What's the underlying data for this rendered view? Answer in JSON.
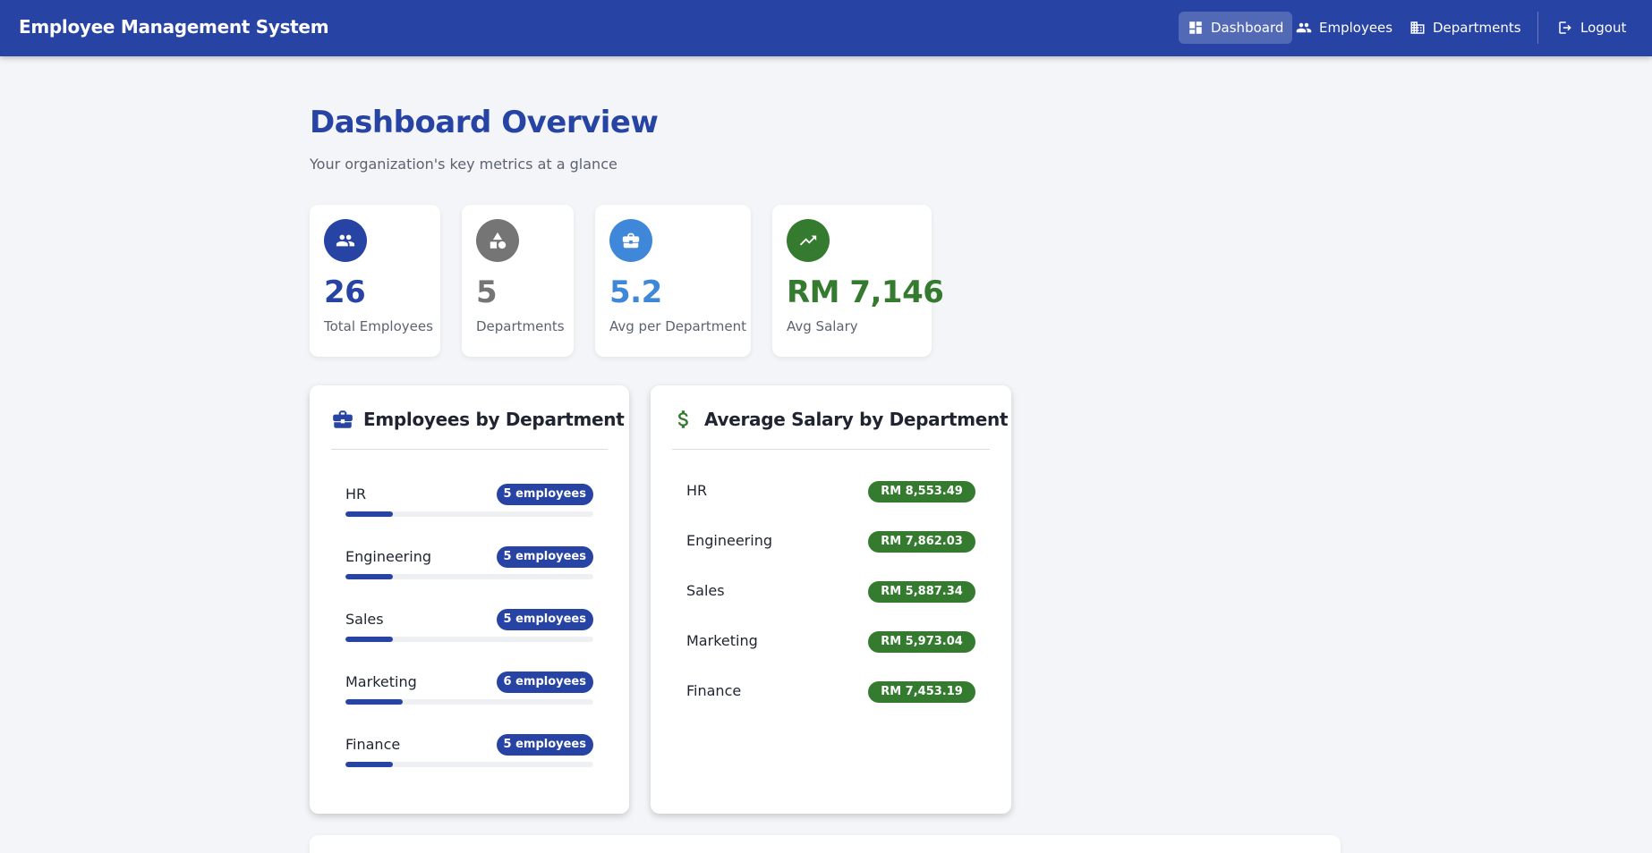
{
  "app": {
    "title": "Employee Management System"
  },
  "nav": {
    "items": [
      {
        "label": "Dashboard",
        "icon": "dashboard-icon",
        "active": true
      },
      {
        "label": "Employees",
        "icon": "people-icon",
        "active": false
      },
      {
        "label": "Departments",
        "icon": "building-icon",
        "active": false
      }
    ],
    "logout": {
      "label": "Logout",
      "icon": "logout-icon"
    }
  },
  "header": {
    "title": "Dashboard Overview",
    "subtitle": "Your organization's key metrics at a glance"
  },
  "stats": [
    {
      "value": "26",
      "label": "Total Employees",
      "icon": "people-icon",
      "color": "#2744a4",
      "icon_bg": "#2744a4"
    },
    {
      "value": "5",
      "label": "Departments",
      "icon": "shapes-icon",
      "color": "#757575",
      "icon_bg": "#757575"
    },
    {
      "value": "5.2",
      "label": "Avg per Department",
      "icon": "briefcase-icon",
      "color": "#3f87d8",
      "icon_bg": "#3f87d8"
    },
    {
      "value": "RM 7,146",
      "label": "Avg Salary",
      "icon": "trending-up-icon",
      "color": "#357b2f",
      "icon_bg": "#357b2f"
    }
  ],
  "employees_by_department": {
    "title": "Employees by Department",
    "icon": "briefcase-icon",
    "rows": [
      {
        "name": "HR",
        "badge": "5 employees",
        "fraction": 0.192
      },
      {
        "name": "Engineering",
        "badge": "5 employees",
        "fraction": 0.192
      },
      {
        "name": "Sales",
        "badge": "5 employees",
        "fraction": 0.192
      },
      {
        "name": "Marketing",
        "badge": "6 employees",
        "fraction": 0.231
      },
      {
        "name": "Finance",
        "badge": "5 employees",
        "fraction": 0.192
      }
    ]
  },
  "salary_by_department": {
    "title": "Average Salary by Department",
    "icon": "dollar-icon",
    "rows": [
      {
        "name": "HR",
        "value": "RM 8,553.49"
      },
      {
        "name": "Engineering",
        "value": "RM 7,862.03"
      },
      {
        "name": "Sales",
        "value": "RM 5,887.34"
      },
      {
        "name": "Marketing",
        "value": "RM 5,973.04"
      },
      {
        "name": "Finance",
        "value": "RM 7,453.19"
      }
    ]
  },
  "colors": {
    "primary": "#2744a4",
    "success": "#357b2f",
    "background": "#f3f5f8"
  }
}
